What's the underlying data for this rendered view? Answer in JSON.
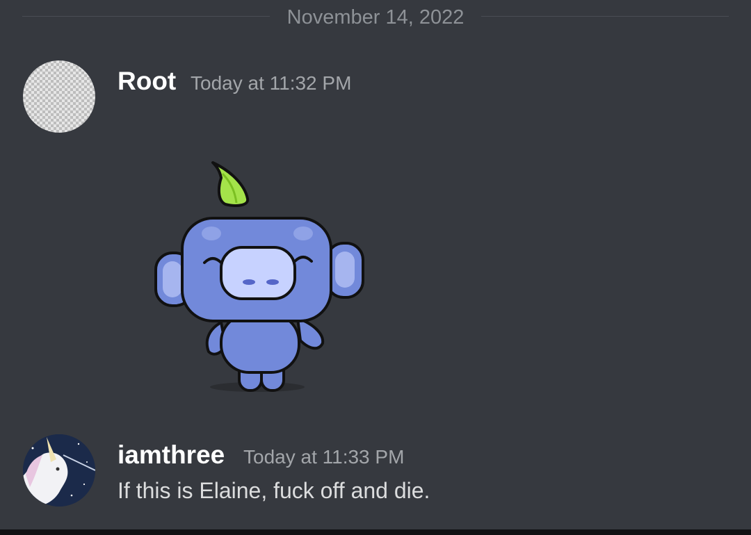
{
  "divider": {
    "date": "November 14, 2022"
  },
  "messages": [
    {
      "username": "Root",
      "timestamp": "Today at 11:32 PM",
      "avatar_icon": "transparent-avatar-icon",
      "attachment": "wumpus-sticker"
    },
    {
      "username": "iamthree",
      "timestamp": "Today at 11:33 PM",
      "avatar_icon": "unicorn-avatar-icon",
      "text": "If this is Elaine, fuck off and die."
    }
  ],
  "colors": {
    "background": "#36393f",
    "username": "#ffffff",
    "timestamp": "#a3a6aa",
    "message_text": "#dcddde",
    "wumpus_body": "#7289da",
    "wumpus_leaf": "#a4e34a"
  }
}
